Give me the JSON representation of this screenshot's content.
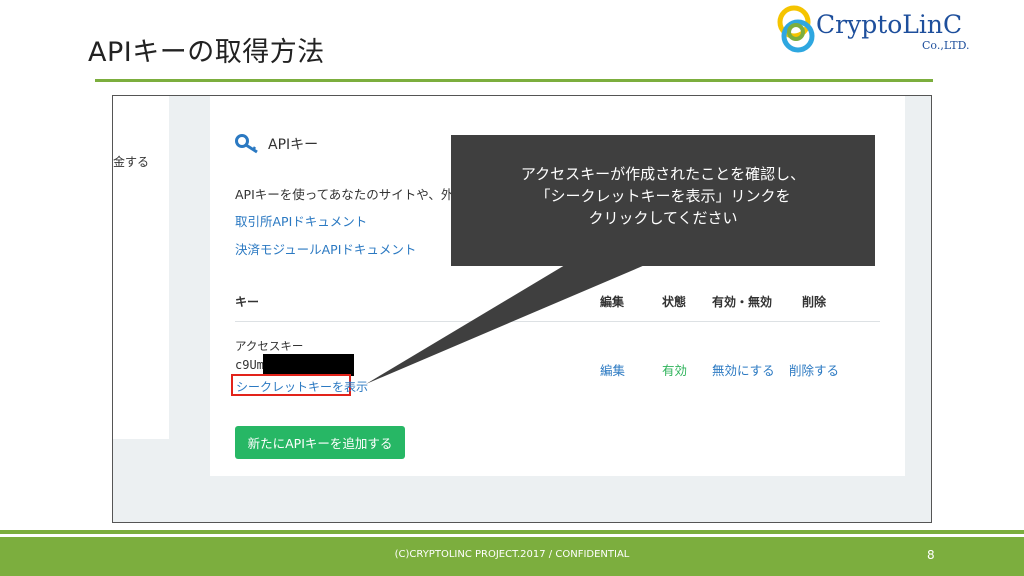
{
  "slide": {
    "title": "APIキーの取得方法",
    "footer": "(C)CRYPTOLINC PROJECT.2017 / CONFIDENTIAL",
    "page_number": "8"
  },
  "logo": {
    "name": "CryptoLinC",
    "sub": "Co.,LTD.",
    "colors": [
      "#1e4f9c",
      "#f5c400",
      "#2ea7e0",
      "#7cae3e"
    ]
  },
  "screenshot": {
    "left_label": "金する",
    "api_heading": "APIキー",
    "description": "APIキーを使ってあなたのサイトや、外",
    "links": {
      "exchange_api": "取引所APIドキュメント",
      "payment_api": "決済モジュールAPIドキュメント"
    },
    "table": {
      "headers": {
        "key": "キー",
        "edit": "編集",
        "status": "状態",
        "toggle": "有効・無効",
        "delete": "削除"
      },
      "row": {
        "key_label": "アクセスキー",
        "key_value": "c9Um",
        "reveal_link": "シークレットキーを表示",
        "edit": "編集",
        "status": "有効",
        "toggle": "無効にする",
        "delete": "削除する"
      }
    },
    "add_button": "新たにAPIキーを追加する"
  },
  "callout": {
    "lines": [
      "アクセスキーが作成されたことを確認し、",
      "「シークレットキーを表示」リンクを",
      "クリックしてください"
    ]
  },
  "colors": {
    "accent_green": "#7cae3e",
    "link_blue": "#2b79c2",
    "status_green": "#2fb35b",
    "button_green": "#27b765",
    "highlight_red": "#e2231a",
    "callout_bg": "#3f3f3f"
  }
}
